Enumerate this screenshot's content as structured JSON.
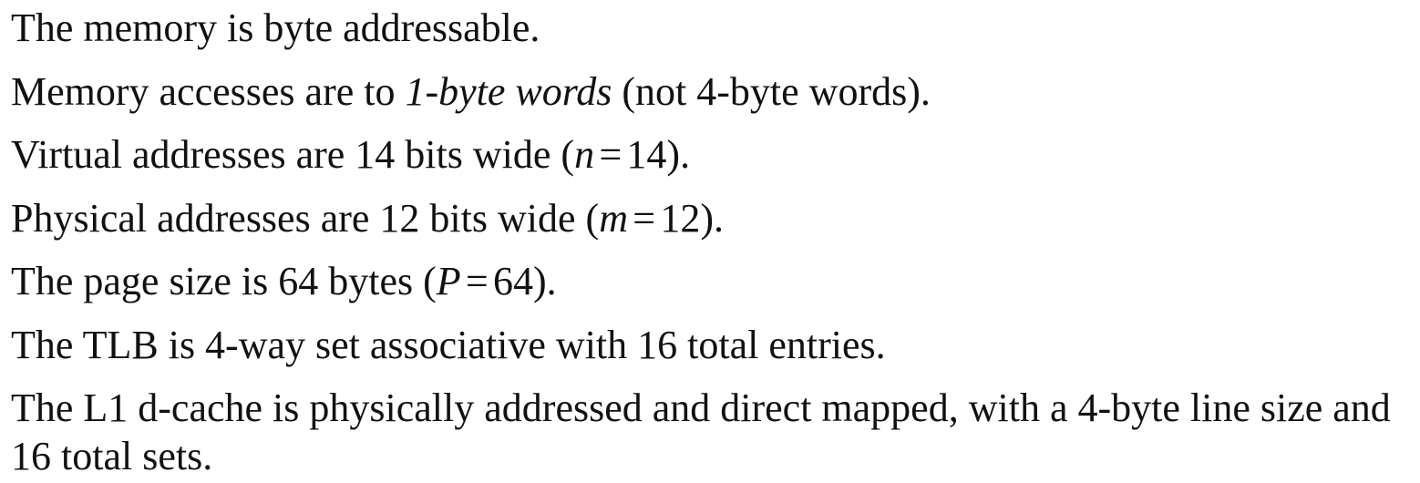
{
  "lines": {
    "l1": "The memory is byte addressable.",
    "l2": {
      "before": "Memory accesses are to ",
      "italic": "1-byte words",
      "after": " (not 4-byte words)."
    },
    "l3": {
      "before": "Virtual addresses are 14 bits wide (",
      "var": "n",
      "eq": "=",
      "value": "14",
      "after": ")."
    },
    "l4": {
      "before": "Physical addresses are 12 bits wide (",
      "var": "m",
      "eq": "=",
      "value": "12",
      "after": ")."
    },
    "l5": {
      "before": "The page size is 64 bytes (",
      "var": "P",
      "eq": "=",
      "value": "64",
      "after": ")."
    },
    "l6": "The TLB is 4-way set associative with 16 total entries.",
    "l7": "The L1 d-cache is physically addressed and direct mapped, with a 4-byte line size and 16 total sets."
  }
}
